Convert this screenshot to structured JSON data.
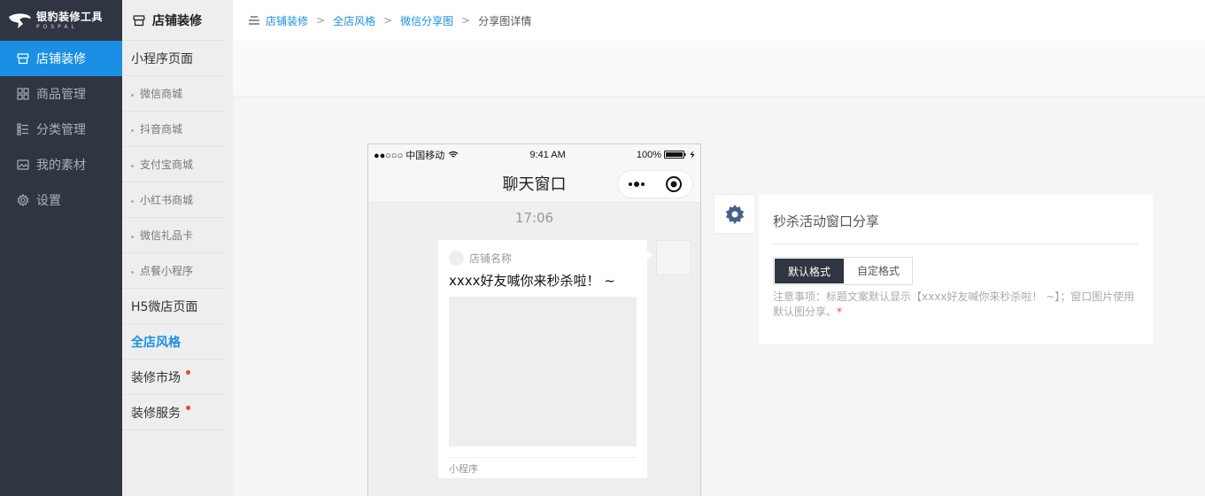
{
  "logo": {
    "title": "银豹装修工具",
    "subtitle": "POSPAL"
  },
  "nav": {
    "items": [
      {
        "label": "店铺装修",
        "icon": "shop-icon"
      },
      {
        "label": "商品管理",
        "icon": "grid-icon"
      },
      {
        "label": "分类管理",
        "icon": "list-icon"
      },
      {
        "label": "我的素材",
        "icon": "image-icon"
      },
      {
        "label": "设置",
        "icon": "gear-icon"
      }
    ]
  },
  "submenu": {
    "title": "店铺装修",
    "group_miniapp": "小程序页面",
    "items": [
      "微信商城",
      "抖音商城",
      "支付宝商城",
      "小红书商城",
      "微信礼品卡",
      "点餐小程序"
    ],
    "group_h5": "H5微店页面",
    "group_style": "全店风格",
    "group_market": "装修市场",
    "group_service": "装修服务"
  },
  "breadcrumb": {
    "items": [
      "店铺装修",
      "全店风格",
      "微信分享图"
    ],
    "current": "分享图详情",
    "separator": ">"
  },
  "phone": {
    "carrier": "●●○○○ 中国移动",
    "time": "9:41 AM",
    "battery": "100%",
    "title": "聊天窗口",
    "chat_time": "17:06",
    "card": {
      "shop_name": "店铺名称",
      "title": "xxxx好友喊你来秒杀啦！ ~",
      "footer": "小程序"
    }
  },
  "panel": {
    "title": "秒杀活动窗口分享",
    "tabs": [
      "默认格式",
      "自定格式"
    ],
    "note": "注意事项：标题文案默认显示【xxxx好友喊你来秒杀啦！ ~】；窗口图片使用默认图分享。",
    "note_star": "*"
  },
  "colors": {
    "accent": "#1a8fe3",
    "sidebar": "#2f3541",
    "red_dot": "#f04040"
  }
}
